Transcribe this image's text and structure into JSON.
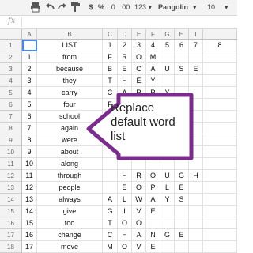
{
  "toolbar": {
    "percent": "%",
    "decimal_less": ".0",
    "decimal_more": ".00",
    "number_format": "123 ▾",
    "font": "Pangolin",
    "font_size": "10"
  },
  "fx_label": "fx",
  "columns": [
    "A",
    "B",
    "C",
    "D",
    "E",
    "F",
    "G",
    "H",
    "I"
  ],
  "rows": [
    {
      "n": "1",
      "a": "",
      "b": "LIST",
      "c": "1",
      "d": "2",
      "e": "3",
      "f": "4",
      "g": "5",
      "h": "6",
      "i": "7",
      "j": "8"
    },
    {
      "n": "2",
      "a": "1",
      "b": "from",
      "c": "F",
      "d": "R",
      "e": "O",
      "f": "M",
      "g": "",
      "h": "",
      "i": "",
      "j": ""
    },
    {
      "n": "3",
      "a": "2",
      "b": "because",
      "c": "B",
      "d": "E",
      "e": "C",
      "f": "A",
      "g": "U",
      "h": "S",
      "i": "E",
      "j": ""
    },
    {
      "n": "4",
      "a": "3",
      "b": "they",
      "c": "T",
      "d": "H",
      "e": "E",
      "f": "Y",
      "g": "",
      "h": "",
      "i": "",
      "j": ""
    },
    {
      "n": "5",
      "a": "4",
      "b": "carry",
      "c": "C",
      "d": "A",
      "e": "R",
      "f": "R",
      "g": "Y",
      "h": "",
      "i": "",
      "j": ""
    },
    {
      "n": "6",
      "a": "5",
      "b": "four",
      "c": "F",
      "d": "O",
      "e": "U",
      "f": "R",
      "g": "",
      "h": "",
      "i": "",
      "j": ""
    },
    {
      "n": "7",
      "a": "6",
      "b": "school",
      "c": "",
      "d": "",
      "e": "",
      "f": "",
      "g": "",
      "h": "L",
      "i": "",
      "j": ""
    },
    {
      "n": "8",
      "a": "7",
      "b": "again",
      "c": "",
      "d": "",
      "e": "",
      "f": "",
      "g": "",
      "h": "",
      "i": "",
      "j": ""
    },
    {
      "n": "9",
      "a": "8",
      "b": "were",
      "c": "",
      "d": "",
      "e": "",
      "f": "",
      "g": "",
      "h": "",
      "i": "",
      "j": ""
    },
    {
      "n": "10",
      "a": "9",
      "b": "about",
      "c": "",
      "d": "",
      "e": "",
      "f": "",
      "g": "",
      "h": "",
      "i": "",
      "j": ""
    },
    {
      "n": "11",
      "a": "10",
      "b": "along",
      "c": "",
      "d": "",
      "e": "",
      "f": "",
      "g": "",
      "h": "",
      "i": "",
      "j": ""
    },
    {
      "n": "12",
      "a": "11",
      "b": "through",
      "c": "",
      "d": "H",
      "e": "R",
      "f": "O",
      "g": "U",
      "h": "G",
      "i": "H",
      "j": ""
    },
    {
      "n": "13",
      "a": "12",
      "b": "people",
      "c": "",
      "d": "E",
      "e": "O",
      "f": "P",
      "g": "L",
      "h": "E",
      "i": "",
      "j": ""
    },
    {
      "n": "14",
      "a": "13",
      "b": "always",
      "c": "A",
      "d": "L",
      "e": "W",
      "f": "A",
      "g": "Y",
      "h": "S",
      "i": "",
      "j": ""
    },
    {
      "n": "15",
      "a": "14",
      "b": "give",
      "c": "G",
      "d": "I",
      "e": "V",
      "f": "E",
      "g": "",
      "h": "",
      "i": "",
      "j": ""
    },
    {
      "n": "16",
      "a": "15",
      "b": "too",
      "c": "T",
      "d": "O",
      "e": "O",
      "f": "",
      "g": "",
      "h": "",
      "i": "",
      "j": ""
    },
    {
      "n": "17",
      "a": "16",
      "b": "change",
      "c": "C",
      "d": "H",
      "e": "A",
      "f": "N",
      "g": "G",
      "h": "E",
      "i": "",
      "j": ""
    },
    {
      "n": "18",
      "a": "17",
      "b": "move",
      "c": "M",
      "d": "O",
      "e": "V",
      "f": "E",
      "g": "",
      "h": "",
      "i": "",
      "j": ""
    }
  ],
  "callout": {
    "line1": "Replace",
    "line2": "default word",
    "line3": "list"
  }
}
